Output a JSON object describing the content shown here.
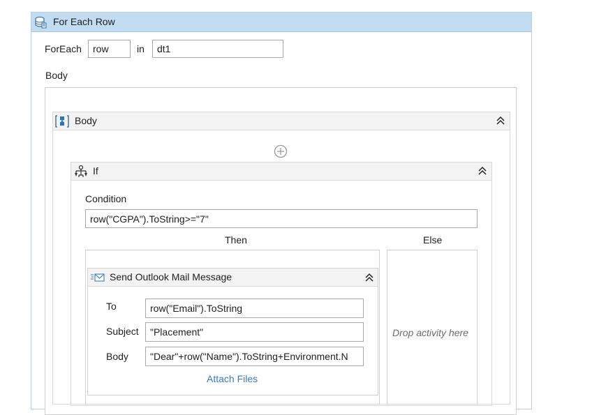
{
  "foreach": {
    "title": "For Each Row",
    "foreach_label": "ForEach",
    "item_value": "row",
    "in_label": "in",
    "collection_value": "dt1",
    "body_label": "Body"
  },
  "sequence": {
    "title": "Body",
    "add_icon": "plus-circle-icon"
  },
  "if_activity": {
    "title": "If",
    "condition_label": "Condition",
    "condition_value": "row(\"CGPA\").ToString>=\"7\"",
    "then_label": "Then",
    "else_label": "Else",
    "else_drop_hint": "Drop activity here"
  },
  "mail": {
    "title": "Send Outlook Mail Message",
    "to_label": "To",
    "to_value": "row(\"Email\").ToString",
    "subject_label": "Subject",
    "subject_value": "\"Placement\"",
    "body_label": "Body",
    "body_value": "\"Dear\"+row(\"Name\").ToString+Environment.N",
    "attach_label": "Attach Files"
  },
  "colors": {
    "header_blue": "#c2ddf2",
    "header_gray": "#f3f3f3",
    "link": "#3a7bc0"
  }
}
